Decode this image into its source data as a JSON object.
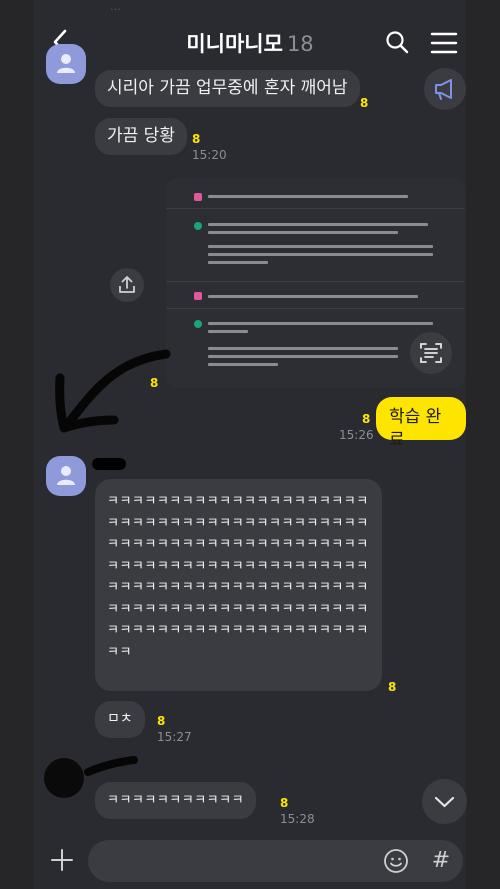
{
  "header": {
    "title": "미니마니모",
    "member_count": "18",
    "faded_top_text": "…"
  },
  "messages": {
    "m1_text": "시리아 가끔 업무중에 혼자 깨어남",
    "m1_unread": "8",
    "m2_text": "가끔 당황",
    "m2_unread": "8",
    "m2_time": "15:20",
    "screenshot_unread": "8",
    "mine_text": "학습 완료",
    "mine_unread": "8",
    "mine_time": "15:26",
    "laugh_text": "ㅋㅋㅋㅋㅋㅋㅋㅋㅋㅋㅋㅋㅋㅋㅋㅋㅋㅋㅋㅋㅋㅋㅋㅋㅋㅋㅋㅋㅋㅋㅋㅋㅋㅋㅋㅋㅋㅋㅋㅋㅋㅋㅋㅋㅋㅋㅋㅋㅋㅋㅋㅋㅋㅋㅋㅋㅋㅋㅋㅋㅋㅋㅋㅋㅋㅋㅋㅋㅋㅋㅋㅋㅋㅋㅋㅋㅋㅋㅋㅋㅋㅋㅋㅋㅋㅋㅋㅋㅋㅋㅋㅋㅋㅋㅋㅋㅋㅋㅋㅋㅋㅋㅋㅋㅋㅋㅋㅋㅋㅋㅋㅋㅋㅋㅋㅋㅋㅋㅋㅋㅋㅋㅋㅋㅋㅋㅋㅋㅋㅋㅋㅋㅋㅋㅋㅋㅋㅋㅋㅋㅋㅋㅋㅋㅋㅋㅋㅋㅋ",
    "laugh_unread": "8",
    "m3_text": "ㅁㅊ",
    "m3_unread": "8",
    "m3_time": "15:27",
    "m4_text": "ㅋㅋㅋㅋㅋㅋㅋㅋㅋㅋㅋ",
    "m4_unread": "8",
    "m4_time": "15:28"
  },
  "input": {
    "placeholder": "",
    "hash_label": "#"
  },
  "colors": {
    "accent_yellow": "#fee500",
    "bubble": "#3b3c41",
    "background": "#2a2b30",
    "avatar": "#8e9ad9"
  },
  "icons": [
    "back-arrow-icon",
    "search-icon",
    "menu-icon",
    "announcement-icon",
    "share-icon",
    "scan-text-icon",
    "chevron-down-icon",
    "plus-icon",
    "emoji-icon",
    "hash-icon"
  ]
}
